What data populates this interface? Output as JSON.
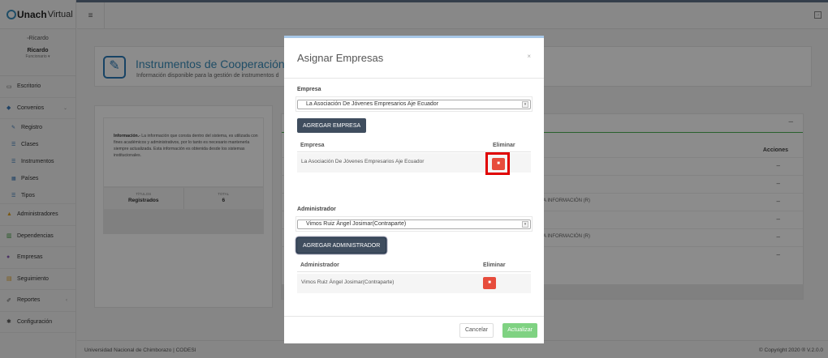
{
  "app": {
    "brand_bold": "Unach",
    "brand_light": "Virtual"
  },
  "profile": {
    "avatar_alt": "Ricardo",
    "name": "Ricardo",
    "role": "Funcionario ▾"
  },
  "sidebar": {
    "items": [
      {
        "label": "Escritorio",
        "icon": "monitor-icon"
      },
      {
        "label": "Convenios",
        "icon": "graduation-cap-icon"
      },
      {
        "label": "Registro",
        "icon": "edit-icon"
      },
      {
        "label": "Clases",
        "icon": "list-icon"
      },
      {
        "label": "Instrumentos",
        "icon": "list-icon"
      },
      {
        "label": "Países",
        "icon": "map-icon"
      },
      {
        "label": "Tipos",
        "icon": "list-icon"
      },
      {
        "label": "Administradores",
        "icon": "warning-icon"
      },
      {
        "label": "Dependencias",
        "icon": "bank-icon"
      },
      {
        "label": "Empresas",
        "icon": "users-icon"
      },
      {
        "label": "Seguimiento",
        "icon": "table-icon"
      },
      {
        "label": "Reportes",
        "icon": "pencil-icon"
      },
      {
        "label": "Configuración",
        "icon": "gear-icon"
      }
    ]
  },
  "page": {
    "title": "Instrumentos de Cooperación",
    "subtitle": "Información disponible para la gestión de instrumentos d",
    "info_bold": "Información.-",
    "info_text": " La información que consta dentro del sistema, es utilizada con fines académicos y administrativos, por lo tanto es necesario mantenerla siempre actualizada. Esta información es obtenida desde los sistemas institucionales.",
    "stats": [
      {
        "label": "TÍTULOS",
        "value": "Registrados"
      },
      {
        "label": "TOTAL",
        "value": "6"
      }
    ],
    "table": {
      "actions_header": "Acciones",
      "minus": "–",
      "rows": [
        {
          "text": "",
          "action": "–"
        },
        {
          "text": "",
          "action": "–"
        },
        {
          "text": "A INFORMACIÓN (R)",
          "action": "–"
        },
        {
          "text": "",
          "action": "–"
        },
        {
          "text": "A INFORMACIÓN (R)",
          "action": "–"
        },
        {
          "text": "",
          "action": "–"
        }
      ]
    }
  },
  "footer": {
    "left": "Universidad Nacional de Chimborazo | CODESI",
    "right": "© Copyright 2020 ® V.2.0.0"
  },
  "modal": {
    "title": "Asignar Empresas",
    "close": "×",
    "empresa_label": "Empresa",
    "empresa_selected": "La Asociación De Jóvenes Empresarios Aje Ecuador",
    "add_empresa": "AGREGAR EMPRESA",
    "empresa_table": {
      "col1": "Empresa",
      "col2": "Eliminar",
      "rows": [
        {
          "name": "La Asociación De Jóvenes Empresarios Aje Ecuador"
        }
      ]
    },
    "admin_label": "Administrador",
    "admin_selected": "Vimos Ruiz Ángel Josimar(Contraparte)",
    "add_admin": "AGREGAR ADMINISTRADOR",
    "admin_table": {
      "col1": "Administrador",
      "col2": "Eliminar",
      "rows": [
        {
          "name": "Vimos Ruiz Ángel Josimar(Contraparte)"
        }
      ]
    },
    "cancel": "Cancelar",
    "update": "Actualizar"
  }
}
